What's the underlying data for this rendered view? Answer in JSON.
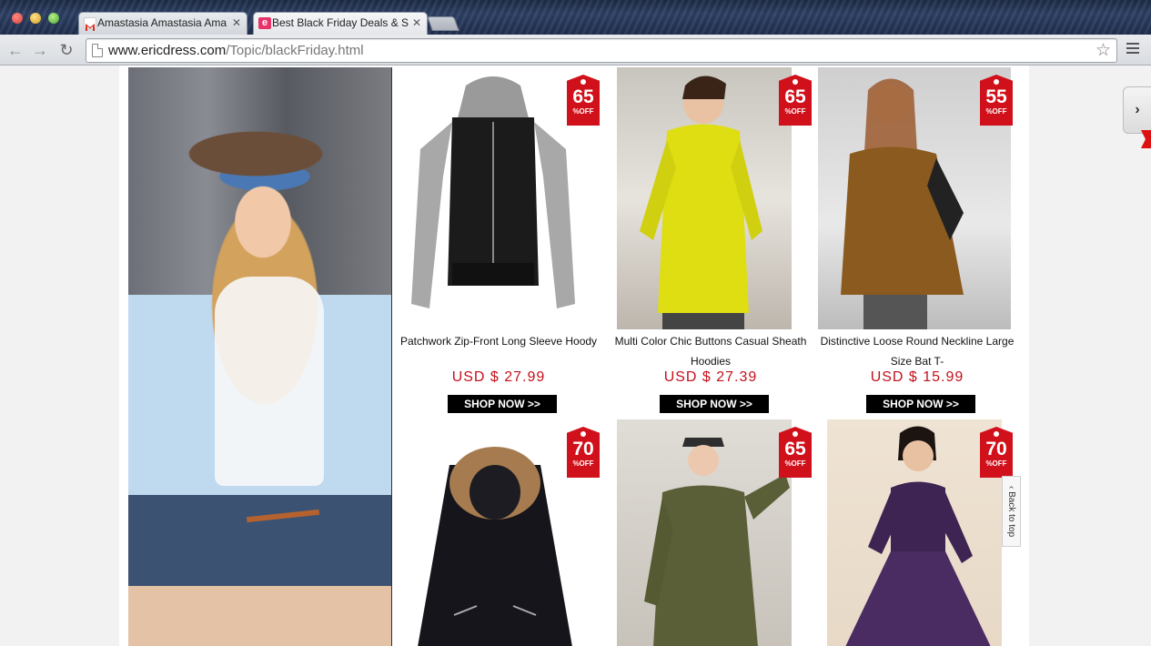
{
  "browser": {
    "tabs": [
      {
        "title": "Amastasia Amastasia Ama",
        "favicon": "gmail-icon",
        "active": false
      },
      {
        "title": "Best Black Friday Deals & S",
        "favicon": "ericdress-icon",
        "active": true
      }
    ],
    "url_domain": "www.ericdress.com",
    "url_path": "/Topic/blackFriday.html"
  },
  "colors": {
    "accent_red": "#d0101a",
    "price_red": "#c4101c",
    "shop_button": "#000000"
  },
  "products": [
    {
      "discount": "65",
      "off_label": "%OFF",
      "name": "Patchwork Zip-Front Long Sleeve Hoody",
      "price": "USD $ 27.99",
      "cta": "SHOP NOW >>"
    },
    {
      "discount": "65",
      "off_label": "%OFF",
      "name": "Multi Color Chic Buttons Casual Sheath Hoodies",
      "price": "USD $ 27.39",
      "cta": "SHOP NOW >>"
    },
    {
      "discount": "55",
      "off_label": "%OFF",
      "name": "Distinctive Loose Round Neckline Large Size Bat T-",
      "price": "USD $ 15.99",
      "cta": "SHOP NOW >>"
    },
    {
      "discount": "70",
      "off_label": "%OFF"
    },
    {
      "discount": "65",
      "off_label": "%OFF"
    },
    {
      "discount": "70",
      "off_label": "%OFF"
    }
  ],
  "back_to_top": "Back to top",
  "side_tab_icon": "chevron-right-icon"
}
